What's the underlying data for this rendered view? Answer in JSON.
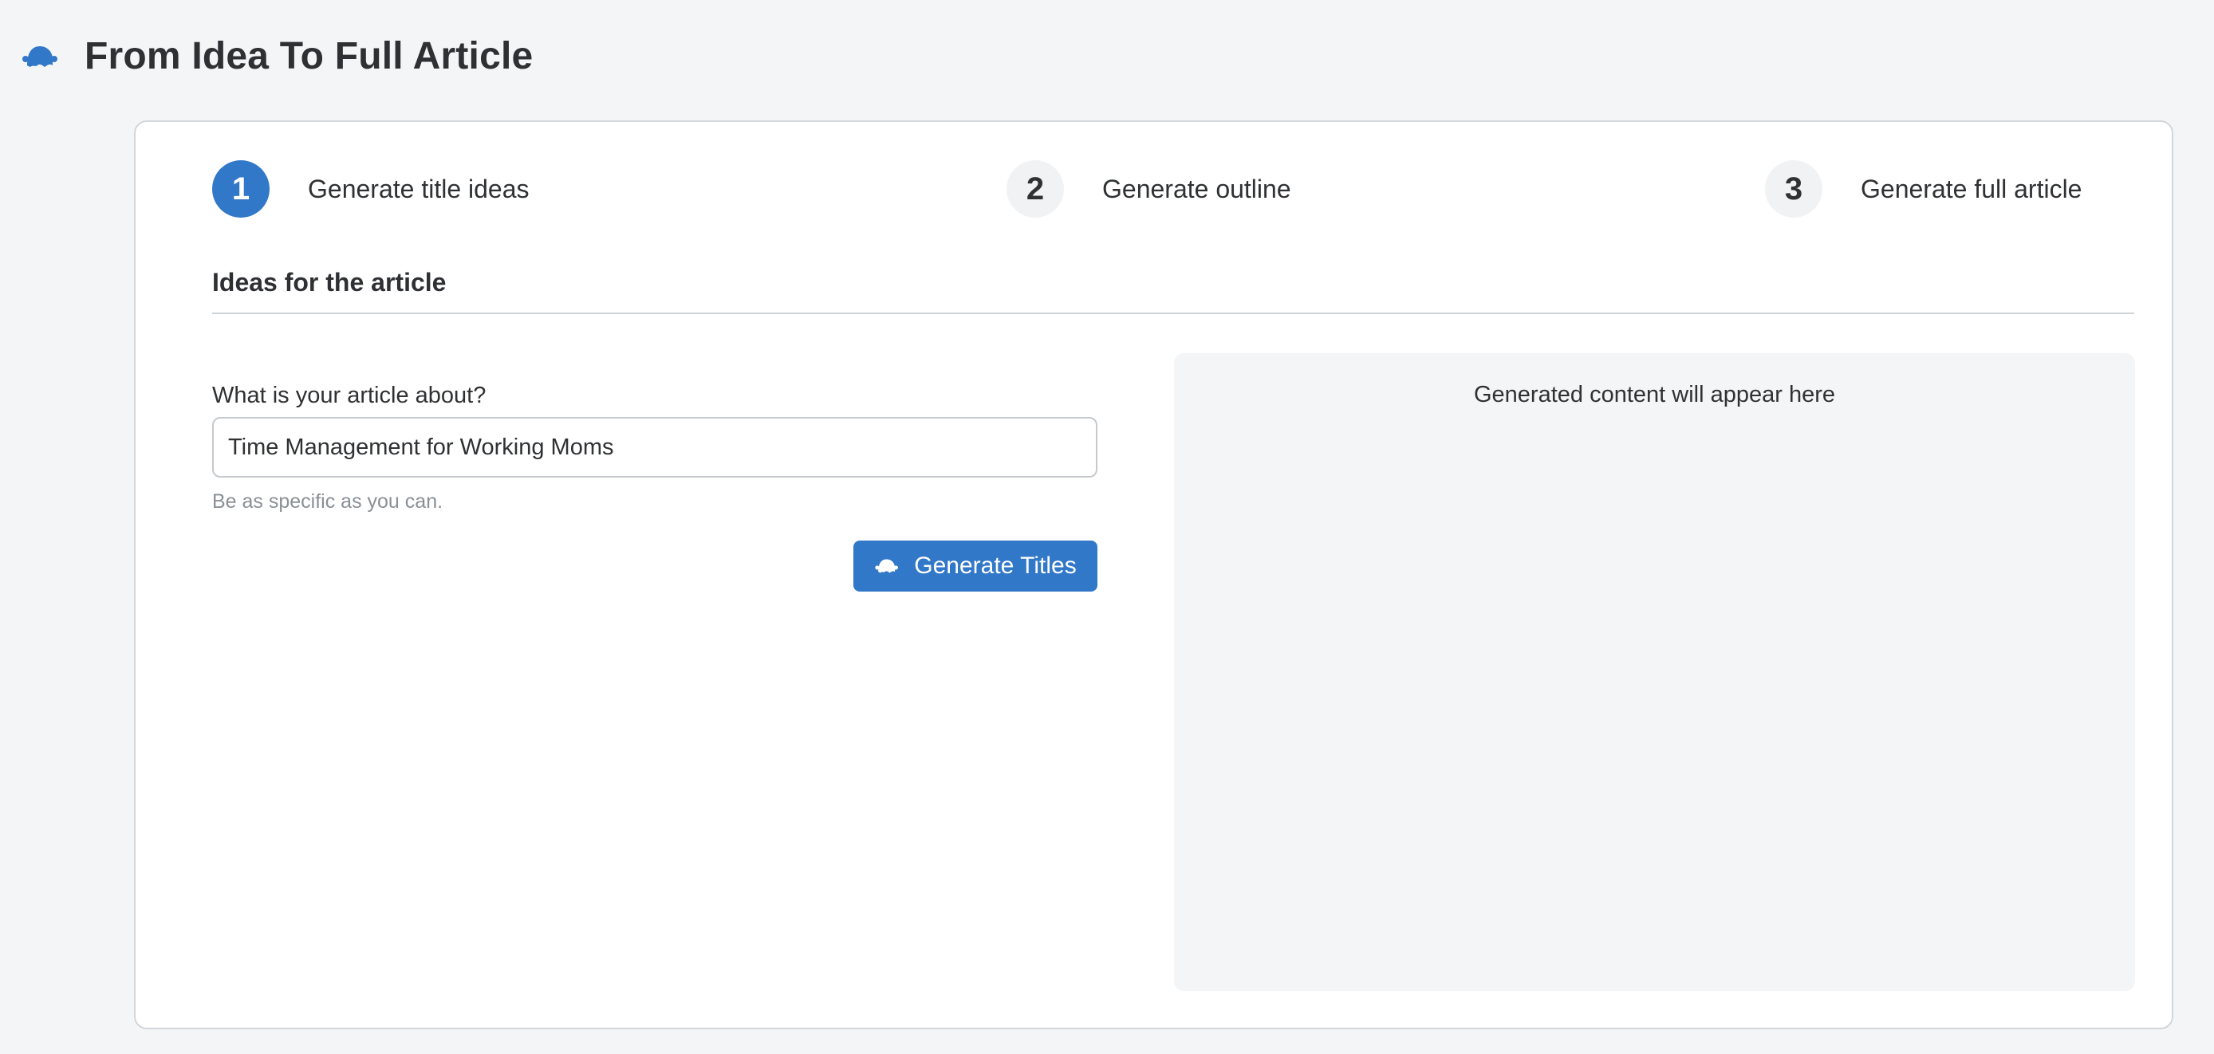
{
  "header": {
    "title": "From Idea To Full Article",
    "logo_icon": "ghost-writer-icon"
  },
  "steps": [
    {
      "number": "1",
      "label": "Generate title ideas",
      "active": true
    },
    {
      "number": "2",
      "label": "Generate outline",
      "active": false
    },
    {
      "number": "3",
      "label": "Generate full article",
      "active": false
    }
  ],
  "section": {
    "title": "Ideas for the article"
  },
  "form": {
    "topic_label": "What is your article about?",
    "topic_value": "Time Management for Working Moms",
    "topic_help": "Be as specific as you can.",
    "generate_button_label": "Generate Titles",
    "generate_button_icon": "ghost-writer-icon"
  },
  "output": {
    "placeholder": "Generated content will appear here"
  },
  "colors": {
    "accent": "#3278c8",
    "background": "#f4f5f7",
    "text": "#2f3133",
    "muted": "#8a9096"
  }
}
